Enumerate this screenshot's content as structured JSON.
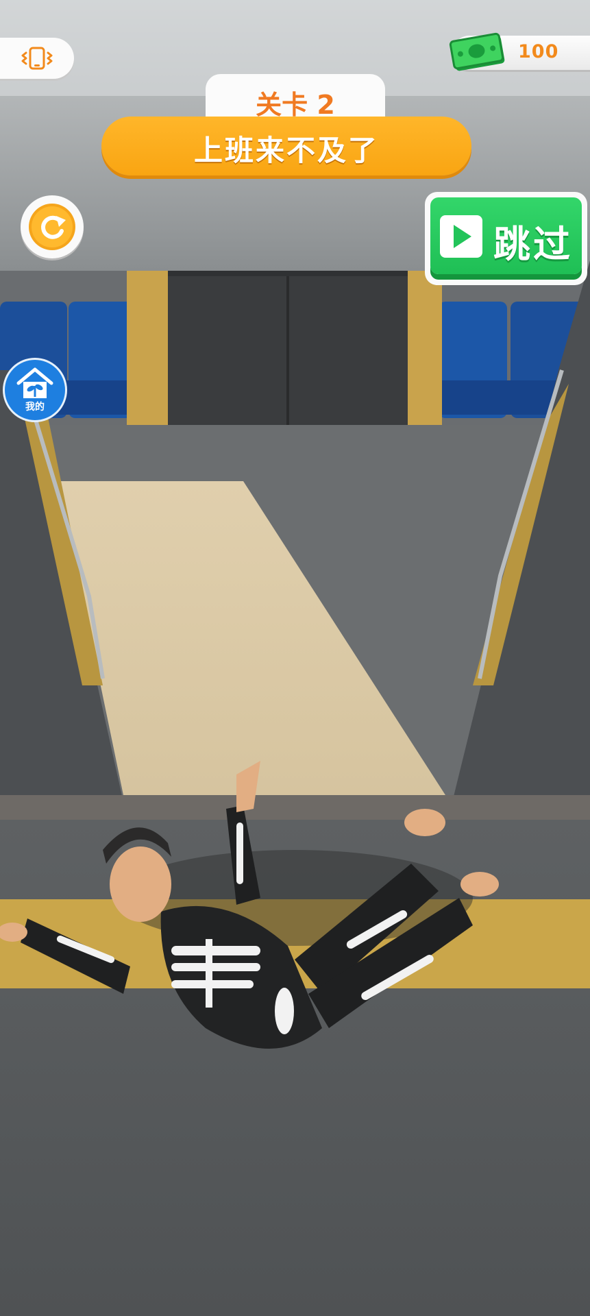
{
  "hud": {
    "coins": "100",
    "level_label": "关卡 2",
    "level_title": "上班来不及了",
    "skip_label": "跳过",
    "mine_label": "我的"
  },
  "icons": {
    "vibrate": "vibrate-phone-icon",
    "cash": "cash-bill-icon",
    "retry": "restart-arrow-icon",
    "skip": "play-icon",
    "mine": "house-plant-icon"
  },
  "colors": {
    "accent_orange": "#f9a512",
    "skip_green": "#1fbf55",
    "coin_text": "#f28a1c",
    "mine_blue": "#1e7fe0"
  }
}
